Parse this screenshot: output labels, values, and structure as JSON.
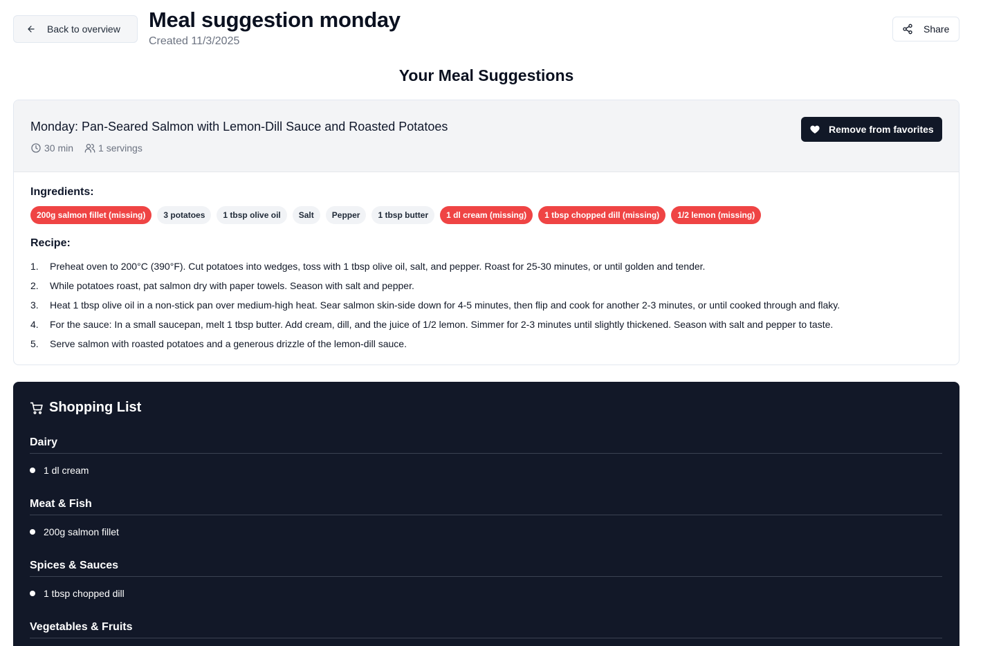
{
  "header": {
    "back_label": "Back to overview",
    "title": "Meal suggestion monday",
    "created": "Created 11/3/2025",
    "share_label": "Share"
  },
  "section_title": "Your Meal Suggestions",
  "meal": {
    "title": "Monday: Pan-Seared Salmon with Lemon-Dill Sauce and Roasted Potatoes",
    "time": "30 min",
    "servings": "1 servings",
    "favorite_label": "Remove from favorites",
    "ingredients_label": "Ingredients:",
    "ingredients": [
      {
        "text": "200g salmon fillet (missing)",
        "missing": true
      },
      {
        "text": "3 potatoes",
        "missing": false
      },
      {
        "text": "1 tbsp olive oil",
        "missing": false
      },
      {
        "text": "Salt",
        "missing": false
      },
      {
        "text": "Pepper",
        "missing": false
      },
      {
        "text": "1 tbsp butter",
        "missing": false
      },
      {
        "text": "1 dl cream (missing)",
        "missing": true
      },
      {
        "text": "1 tbsp chopped dill (missing)",
        "missing": true
      },
      {
        "text": "1/2 lemon (missing)",
        "missing": true
      }
    ],
    "recipe_label": "Recipe:",
    "steps": [
      {
        "num": "1.",
        "text": "Preheat oven to 200°C (390°F). Cut potatoes into wedges, toss with 1 tbsp olive oil, salt, and pepper. Roast for 25-30 minutes, or until golden and tender."
      },
      {
        "num": "2.",
        "text": "While potatoes roast, pat salmon dry with paper towels. Season with salt and pepper."
      },
      {
        "num": "3.",
        "text": "Heat 1 tbsp olive oil in a non-stick pan over medium-high heat. Sear salmon skin-side down for 4-5 minutes, then flip and cook for another 2-3 minutes, or until cooked through and flaky."
      },
      {
        "num": "4.",
        "text": "For the sauce: In a small saucepan, melt 1 tbsp butter. Add cream, dill, and the juice of 1/2 lemon. Simmer for 2-3 minutes until slightly thickened. Season with salt and pepper to taste."
      },
      {
        "num": "5.",
        "text": "Serve salmon with roasted potatoes and a generous drizzle of the lemon-dill sauce."
      }
    ]
  },
  "shopping": {
    "title": "Shopping List",
    "categories": [
      {
        "name": "Dairy",
        "items": [
          "1 dl cream"
        ]
      },
      {
        "name": "Meat & Fish",
        "items": [
          "200g salmon fillet"
        ]
      },
      {
        "name": "Spices & Sauces",
        "items": [
          "1 tbsp chopped dill"
        ]
      },
      {
        "name": "Vegetables & Fruits",
        "items": []
      }
    ]
  },
  "colors": {
    "missing_chip": "#ef4444",
    "dark_panel": "#121828",
    "primary_button": "#111827"
  }
}
